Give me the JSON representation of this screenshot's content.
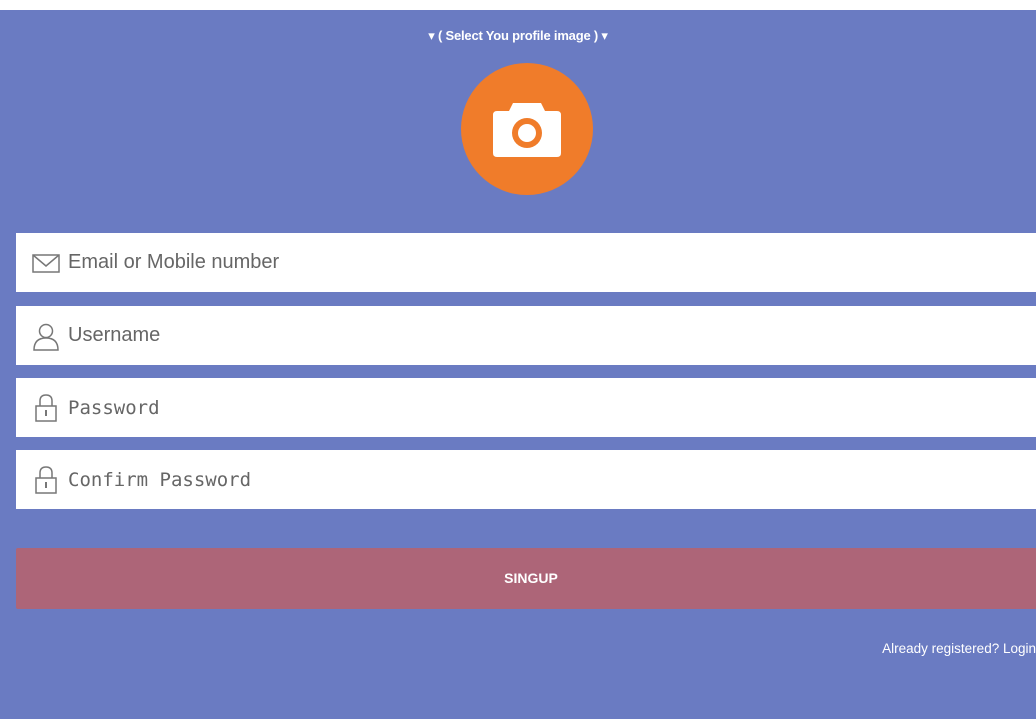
{
  "header": {
    "select_image_label": "▾ ( Select You profile image ) ▾"
  },
  "form": {
    "email_placeholder": "Email or Mobile number",
    "username_placeholder": "Username",
    "password_placeholder": "Password",
    "confirm_password_placeholder": "Confirm Password",
    "submit_label": "SINGUP"
  },
  "footer": {
    "login_link": "Already registered? Login"
  },
  "icons": {
    "camera": "camera-icon",
    "email": "envelope-icon",
    "username": "user-icon",
    "password": "lock-icon",
    "confirm_password": "lock-icon"
  },
  "colors": {
    "background": "#6a7bc2",
    "camera_circle": "#f07c2a",
    "submit_button": "#ad6578",
    "field_background": "#ffffff"
  }
}
